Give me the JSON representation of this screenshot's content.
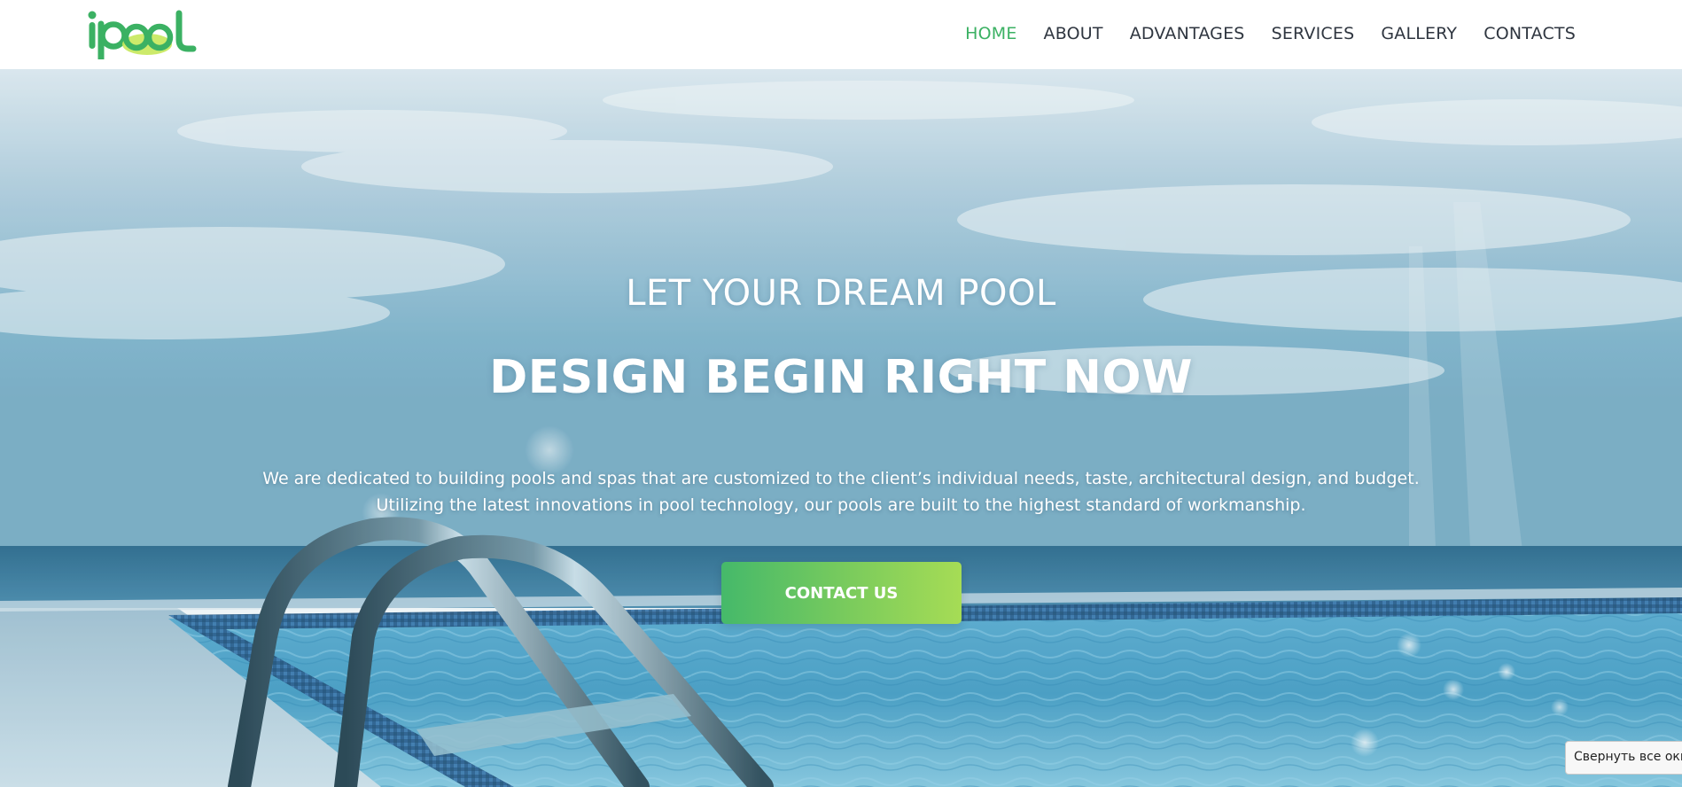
{
  "brand": {
    "logo_text": "ipool",
    "colors": {
      "primary_green": "#3bb163",
      "accent_lime": "#a6dc55"
    }
  },
  "nav": {
    "items": [
      {
        "label": "HOME",
        "active": true
      },
      {
        "label": "ABOUT",
        "active": false
      },
      {
        "label": "ADVANTAGES",
        "active": false
      },
      {
        "label": "SERVICES",
        "active": false
      },
      {
        "label": "GALLERY",
        "active": false
      },
      {
        "label": "CONTACTS",
        "active": false
      }
    ]
  },
  "hero": {
    "kicker": "LET YOUR DREAM POOL",
    "headline": "DESIGN BEGIN RIGHT NOW",
    "description_lines": [
      "We are dedicated to building pools and spas that are customized to the client’s individual needs, taste, architectural design, and budget.",
      "Utilizing the latest innovations in pool technology, our pools are built to the highest standard of workmanship."
    ],
    "cta_label": "CONTACT US"
  },
  "tooltip": {
    "text": "Свернуть все окна"
  }
}
